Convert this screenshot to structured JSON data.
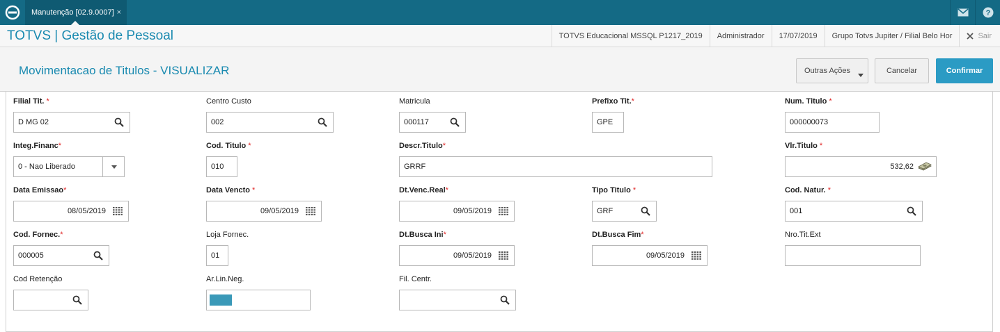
{
  "tab": {
    "title": "Manutenção [02.9.0007]",
    "close": "×"
  },
  "header": {
    "app_title": "TOTVS | Gestão de Pessoal",
    "environment": "TOTVS Educacional MSSQL P1217_2019",
    "user": "Administrador",
    "date": "17/07/2019",
    "branch": "Grupo Totvs Jupiter / Filial Belo Hor",
    "logout_label": "Sair"
  },
  "page": {
    "title": "Movimentacao de Titulos - VISUALIZAR",
    "other_actions_label": "Outras Ações",
    "cancel_label": "Cancelar",
    "confirm_label": "Confirmar"
  },
  "form": {
    "filial_tit": {
      "label": "Filial Tit.",
      "required": "*",
      "value": "D MG 02"
    },
    "centro_custo": {
      "label": "Centro Custo",
      "value": "002"
    },
    "matricula": {
      "label": "Matricula",
      "value": "000117"
    },
    "prefixo_tit": {
      "label": "Prefixo Tit.",
      "required": "*",
      "value": "GPE"
    },
    "num_titulo": {
      "label": "Num. Titulo",
      "required": "*",
      "value": "000000073"
    },
    "integ_financ": {
      "label": "Integ.Financ",
      "required": "*",
      "value": "0 - Nao Liberado"
    },
    "cod_titulo": {
      "label": "Cod. Titulo",
      "required": "*",
      "value": "010"
    },
    "descr_titulo": {
      "label": "Descr.Titulo",
      "required": "*",
      "value": "GRRF"
    },
    "vlr_titulo": {
      "label": "Vlr.Titulo",
      "required": "*",
      "value": "532,62"
    },
    "data_emissao": {
      "label": "Data Emissao",
      "required": "*",
      "value": "08/05/2019"
    },
    "data_vencto": {
      "label": "Data Vencto",
      "required": "*",
      "value": "09/05/2019"
    },
    "dt_venc_real": {
      "label": "Dt.Venc.Real",
      "required": "*",
      "value": "09/05/2019"
    },
    "tipo_titulo": {
      "label": "Tipo Titulo",
      "required": "*",
      "value": "GRF"
    },
    "cod_natur": {
      "label": "Cod. Natur.",
      "required": "*",
      "value": "001"
    },
    "cod_fornec": {
      "label": "Cod. Fornec.",
      "required": "*",
      "value": "000005"
    },
    "loja_fornec": {
      "label": "Loja Fornec.",
      "value": "01"
    },
    "dt_busca_ini": {
      "label": "Dt.Busca Ini",
      "required": "*",
      "value": "09/05/2019"
    },
    "dt_busca_fim": {
      "label": "Dt.Busca Fim",
      "required": "*",
      "value": "09/05/2019"
    },
    "nro_tit_ext": {
      "label": "Nro.Tit.Ext",
      "value": ""
    },
    "cod_retencao": {
      "label": "Cod Retenção",
      "value": ""
    },
    "ar_lin_neg": {
      "label": "Ar.Lin.Neg.",
      "color": "#3a99b8"
    },
    "fil_centr": {
      "label": "Fil. Centr.",
      "value": ""
    }
  },
  "icons": {
    "logo": "totvs-logo-icon",
    "mail": "mail-icon",
    "help": "help-icon",
    "logout": "close-icon",
    "search": "search-icon",
    "calendar": "calendar-icon",
    "money": "money-icon"
  },
  "colors": {
    "topbar": "#146a85",
    "accent": "#1a8ab0",
    "confirm": "#2b9bc4",
    "required": "#e02424"
  }
}
